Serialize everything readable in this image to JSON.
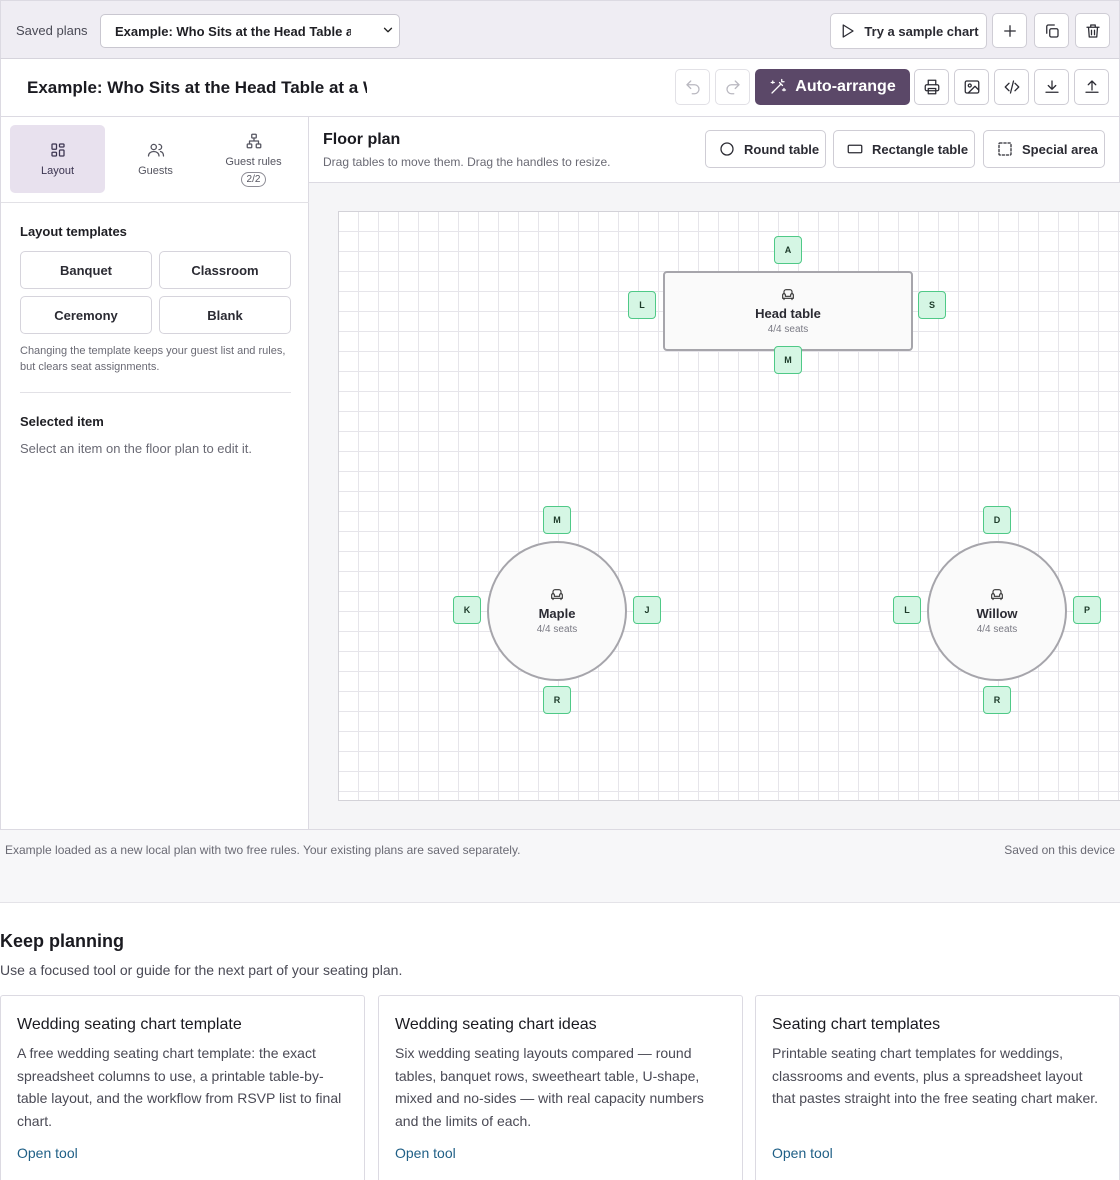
{
  "topbar": {
    "saved_plans_label": "Saved plans",
    "selected_plan": "Example: Who Sits at the Head Table at a Wedding",
    "sample_button": "Try a sample chart"
  },
  "titlebar": {
    "plan_title": "Example: Who Sits at the Head Table at a Wedding",
    "auto_arrange": "Auto-arrange"
  },
  "sidebar": {
    "tabs": [
      {
        "label": "Layout"
      },
      {
        "label": "Guests"
      },
      {
        "label": "Guest rules",
        "badge": "2/2"
      }
    ],
    "templates_heading": "Layout templates",
    "templates": [
      "Banquet",
      "Classroom",
      "Ceremony",
      "Blank"
    ],
    "templates_note": "Changing the template keeps your guest list and rules, but clears seat assignments.",
    "selected_heading": "Selected item",
    "selected_hint": "Select an item on the floor plan to edit it."
  },
  "floor": {
    "title": "Floor plan",
    "subtitle": "Drag tables to move them. Drag the handles to resize.",
    "add_buttons": [
      "Round table",
      "Rectangle table",
      "Special area"
    ],
    "tables": [
      {
        "name": "Head table",
        "seats": "4/4 seats",
        "shape": "rect",
        "seat_labels": [
          "A",
          "L",
          "S",
          "M"
        ]
      },
      {
        "name": "Maple",
        "seats": "4/4 seats",
        "shape": "round",
        "seat_labels": [
          "M",
          "K",
          "J",
          "R"
        ]
      },
      {
        "name": "Willow",
        "seats": "4/4 seats",
        "shape": "round",
        "seat_labels": [
          "D",
          "L",
          "P",
          "R"
        ]
      }
    ]
  },
  "status": {
    "message": "Example loaded as a new local plan with two free rules. Your existing plans are saved separately.",
    "saved": "Saved on this device"
  },
  "keep_planning": {
    "title": "Keep planning",
    "subtitle": "Use a focused tool or guide for the next part of your seating plan.",
    "cards": [
      {
        "title": "Wedding seating chart template",
        "desc": "A free wedding seating chart template: the exact spreadsheet columns to use, a printable table-by-table layout, and the workflow from RSVP list to final chart.",
        "link": "Open tool"
      },
      {
        "title": "Wedding seating chart ideas",
        "desc": "Six wedding seating layouts compared — round tables, banquet rows, sweetheart table, U-shape, mixed and no-sides — with real capacity numbers and the limits of each.",
        "link": "Open tool"
      },
      {
        "title": "Seating chart templates",
        "desc": "Printable seating chart templates for weddings, classrooms and events, plus a spreadsheet layout that pastes straight into the free seating chart maker.",
        "link": "Open tool"
      }
    ]
  },
  "colors": {
    "accent": "#5b4868",
    "seat_fill": "#d5f6e4",
    "seat_border": "#4fc987",
    "link": "#1f5f86"
  }
}
